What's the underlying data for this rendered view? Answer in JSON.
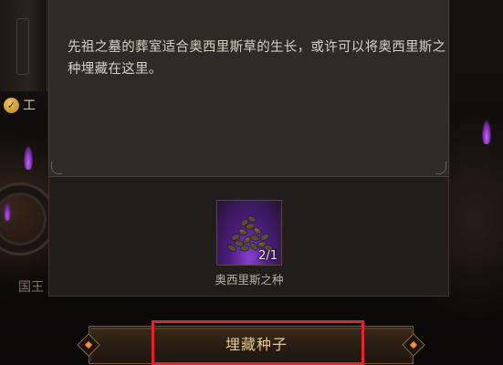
{
  "background": {
    "badge_text": "工",
    "bottom_label": "国王"
  },
  "dialog": {
    "description": "先祖之墓的葬室适合奥西里斯草的生长，或许可以将奥西里斯之种埋藏在这里。"
  },
  "item": {
    "count": "2/1",
    "name": "奥西里斯之种",
    "icon": "seed-pile-icon"
  },
  "actions": {
    "plant_label": "埋藏种子"
  },
  "colors": {
    "panel": "#2e2a26",
    "panel_bottom": "#201d1b",
    "button_text": "#e6c98f",
    "highlight": "#e3242b",
    "rarity_purple": "#8a3fd0"
  }
}
